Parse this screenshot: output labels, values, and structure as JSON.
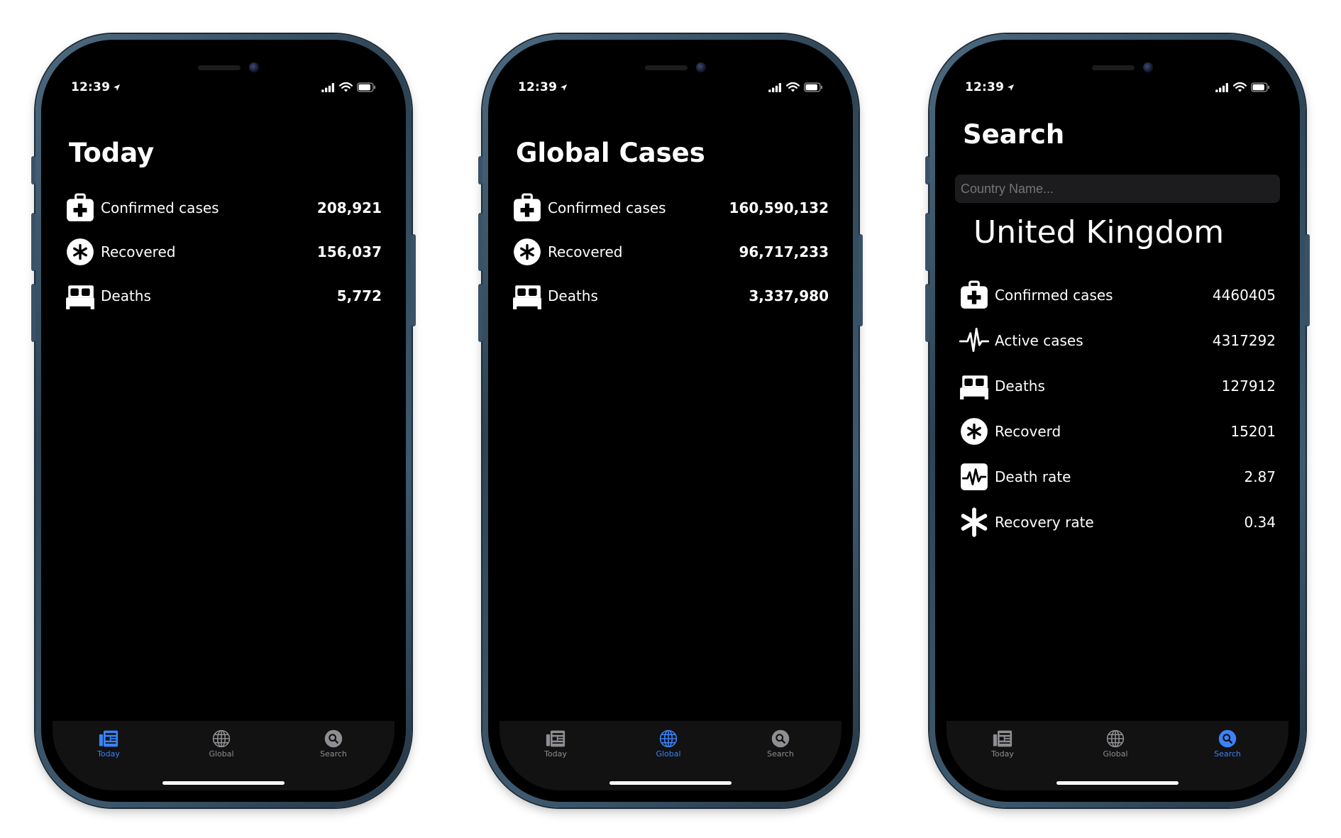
{
  "status_bar": {
    "time": "12:39"
  },
  "colors": {
    "accent": "#3b82f6",
    "inactive_tab": "#8e8e93",
    "background": "#000000"
  },
  "tabs": [
    {
      "label": "Today",
      "icon": "newspaper-icon"
    },
    {
      "label": "Global",
      "icon": "globe-icon"
    },
    {
      "label": "Search",
      "icon": "magnifier-icon"
    }
  ],
  "screens": [
    {
      "title": "Today",
      "active_tab": "Today",
      "rows": [
        {
          "icon": "medical-kit-icon",
          "label": "Confirmed cases",
          "value": "208,921"
        },
        {
          "icon": "asterisk-circle-icon",
          "label": "Recovered",
          "value": "156,037"
        },
        {
          "icon": "bed-icon",
          "label": "Deaths",
          "value": "5,772"
        }
      ]
    },
    {
      "title": "Global Cases",
      "active_tab": "Global",
      "rows": [
        {
          "icon": "medical-kit-icon",
          "label": "Confirmed cases",
          "value": "160,590,132"
        },
        {
          "icon": "asterisk-circle-icon",
          "label": "Recovered",
          "value": "96,717,233"
        },
        {
          "icon": "bed-icon",
          "label": "Deaths",
          "value": "3,337,980"
        }
      ]
    },
    {
      "title": "Search",
      "active_tab": "Search",
      "search": {
        "placeholder": "Country Name..."
      },
      "country": "United Kingdom",
      "rows": [
        {
          "icon": "medical-kit-icon",
          "label": "Confirmed cases",
          "value": "4460405"
        },
        {
          "icon": "waveform-icon",
          "label": "Active cases",
          "value": "4317292"
        },
        {
          "icon": "bed-icon",
          "label": "Deaths",
          "value": "127912"
        },
        {
          "icon": "asterisk-circle-icon",
          "label": "Recoverd",
          "value": "15201"
        },
        {
          "icon": "waveform-box-icon",
          "label": "Death rate",
          "value": "2.87"
        },
        {
          "icon": "asterisk-icon",
          "label": "Recovery rate",
          "value": "0.34"
        }
      ]
    }
  ]
}
